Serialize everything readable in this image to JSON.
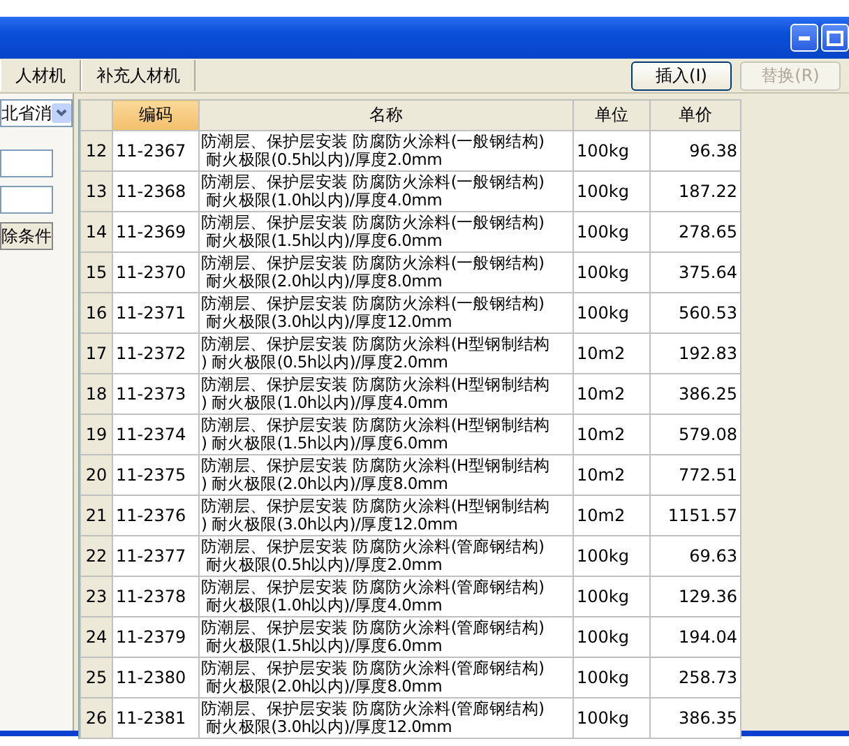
{
  "tabs": [
    {
      "label": "人材机",
      "selected": false
    },
    {
      "label": "补充人材机",
      "selected": false
    }
  ],
  "buttons": [
    {
      "label": "插入(I)",
      "disabled": false
    },
    {
      "label": "替换(R)",
      "disabled": true
    }
  ],
  "filter": {
    "dropdown": "北省消",
    "button": "除条件"
  },
  "table": {
    "columns": [
      {
        "label": "编码",
        "selected": true
      },
      {
        "label": "名称",
        "selected": false
      },
      {
        "label": "单位",
        "selected": false
      },
      {
        "label": "单价",
        "selected": false
      }
    ],
    "rows": [
      {
        "index": "12",
        "code": "11-2367",
        "name": "防潮层、保护层安装 防腐防火涂料(一般钢结构)\n 耐火极限(0.5h以内)/厚度2.0mm",
        "unit": "100kg",
        "price": "96.38"
      },
      {
        "index": "13",
        "code": "11-2368",
        "name": "防潮层、保护层安装 防腐防火涂料(一般钢结构)\n 耐火极限(1.0h以内)/厚度4.0mm",
        "unit": "100kg",
        "price": "187.22"
      },
      {
        "index": "14",
        "code": "11-2369",
        "name": "防潮层、保护层安装 防腐防火涂料(一般钢结构)\n 耐火极限(1.5h以内)/厚度6.0mm",
        "unit": "100kg",
        "price": "278.65"
      },
      {
        "index": "15",
        "code": "11-2370",
        "name": "防潮层、保护层安装 防腐防火涂料(一般钢结构)\n 耐火极限(2.0h以内)/厚度8.0mm",
        "unit": "100kg",
        "price": "375.64"
      },
      {
        "index": "16",
        "code": "11-2371",
        "name": "防潮层、保护层安装 防腐防火涂料(一般钢结构)\n 耐火极限(3.0h以内)/厚度12.0mm",
        "unit": "100kg",
        "price": "560.53"
      },
      {
        "index": "17",
        "code": "11-2372",
        "name": "防潮层、保护层安装 防腐防火涂料(H型钢制结构\n) 耐火极限(0.5h以内)/厚度2.0mm",
        "unit": "10m2",
        "price": "192.83"
      },
      {
        "index": "18",
        "code": "11-2373",
        "name": "防潮层、保护层安装 防腐防火涂料(H型钢制结构\n) 耐火极限(1.0h以内)/厚度4.0mm",
        "unit": "10m2",
        "price": "386.25"
      },
      {
        "index": "19",
        "code": "11-2374",
        "name": "防潮层、保护层安装 防腐防火涂料(H型钢制结构\n) 耐火极限(1.5h以内)/厚度6.0mm",
        "unit": "10m2",
        "price": "579.08"
      },
      {
        "index": "20",
        "code": "11-2375",
        "name": "防潮层、保护层安装 防腐防火涂料(H型钢制结构\n) 耐火极限(2.0h以内)/厚度8.0mm",
        "unit": "10m2",
        "price": "772.51"
      },
      {
        "index": "21",
        "code": "11-2376",
        "name": "防潮层、保护层安装 防腐防火涂料(H型钢制结构\n) 耐火极限(3.0h以内)/厚度12.0mm",
        "unit": "10m2",
        "price": "1151.57"
      },
      {
        "index": "22",
        "code": "11-2377",
        "name": "防潮层、保护层安装 防腐防火涂料(管廊钢结构)\n 耐火极限(0.5h以内)/厚度2.0mm",
        "unit": "100kg",
        "price": "69.63"
      },
      {
        "index": "23",
        "code": "11-2378",
        "name": "防潮层、保护层安装 防腐防火涂料(管廊钢结构)\n 耐火极限(1.0h以内)/厚度4.0mm",
        "unit": "100kg",
        "price": "129.36"
      },
      {
        "index": "24",
        "code": "11-2379",
        "name": "防潮层、保护层安装 防腐防火涂料(管廊钢结构)\n 耐火极限(1.5h以内)/厚度6.0mm",
        "unit": "100kg",
        "price": "194.04"
      },
      {
        "index": "25",
        "code": "11-2380",
        "name": "防潮层、保护层安装 防腐防火涂料(管廊钢结构)\n 耐火极限(2.0h以内)/厚度8.0mm",
        "unit": "100kg",
        "price": "258.73"
      },
      {
        "index": "26",
        "code": "11-2381",
        "name": "防潮层、保护层安装 防腐防火涂料(管廊钢结构)\n 耐火极限(3.0h以内)/厚度12.0mm",
        "unit": "100kg",
        "price": "386.35"
      }
    ]
  }
}
